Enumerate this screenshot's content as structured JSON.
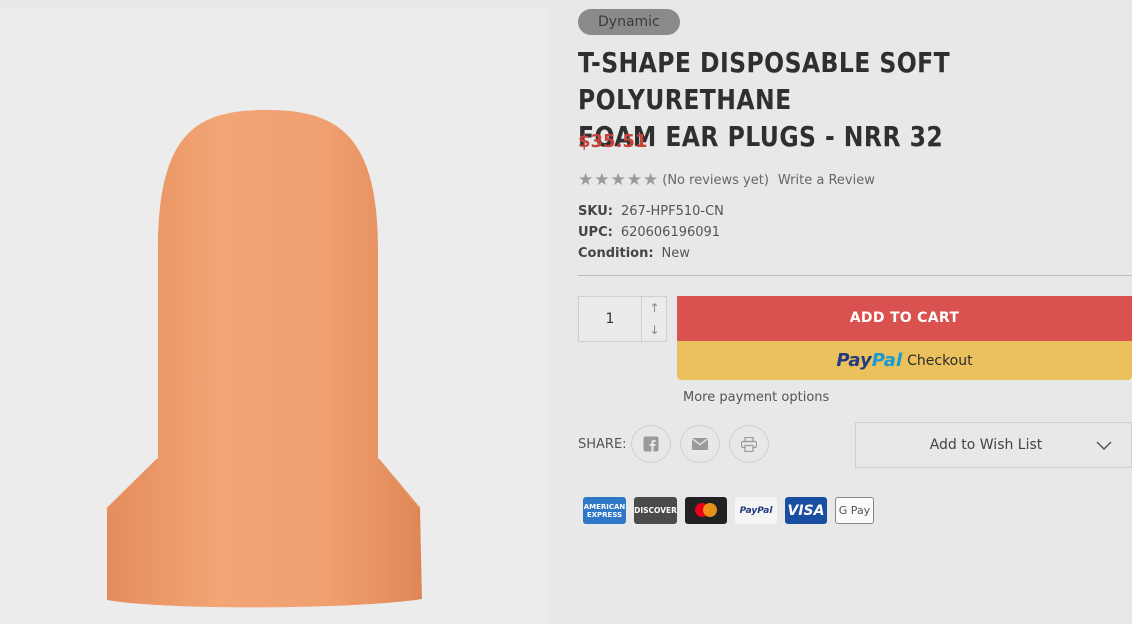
{
  "product": {
    "badge": "Dynamic",
    "title_line1": "T-SHAPE DISPOSABLE SOFT POLYURETHANE",
    "title_line2": "FOAM EAR PLUGS - NRR 32",
    "price": "$35.51",
    "rating_stars": 5,
    "reviews_text": "(No reviews yet)",
    "write_review": "Write a Review",
    "sku_label": "SKU:",
    "sku_value": "267-HPF510-CN",
    "upc_label": "UPC:",
    "upc_value": "620606196091",
    "condition_label": "Condition:",
    "condition_value": "New"
  },
  "purchase": {
    "quantity": "1",
    "add_to_cart": "ADD TO CART",
    "paypal_pay": "Pay",
    "paypal_pal": "Pal",
    "paypal_checkout": "Checkout",
    "more_payment": "More payment options",
    "wishlist": "Add to Wish List"
  },
  "share": {
    "label": "SHARE:",
    "icons": [
      "facebook-icon",
      "email-icon",
      "print-icon"
    ]
  },
  "payment_icons": {
    "amex_line1": "AMERICAN",
    "amex_line2": "EXPRESS",
    "discover": "DISCOVER",
    "paypal": "PayPal",
    "visa": "VISA",
    "gpay": "G Pay"
  },
  "colors": {
    "price": "#c8423c",
    "add_to_cart_bg": "#d9524f",
    "paypal_bg": "#eac15c",
    "badge_bg": "#8a8a8a",
    "product_foam": "#f2a06e"
  }
}
